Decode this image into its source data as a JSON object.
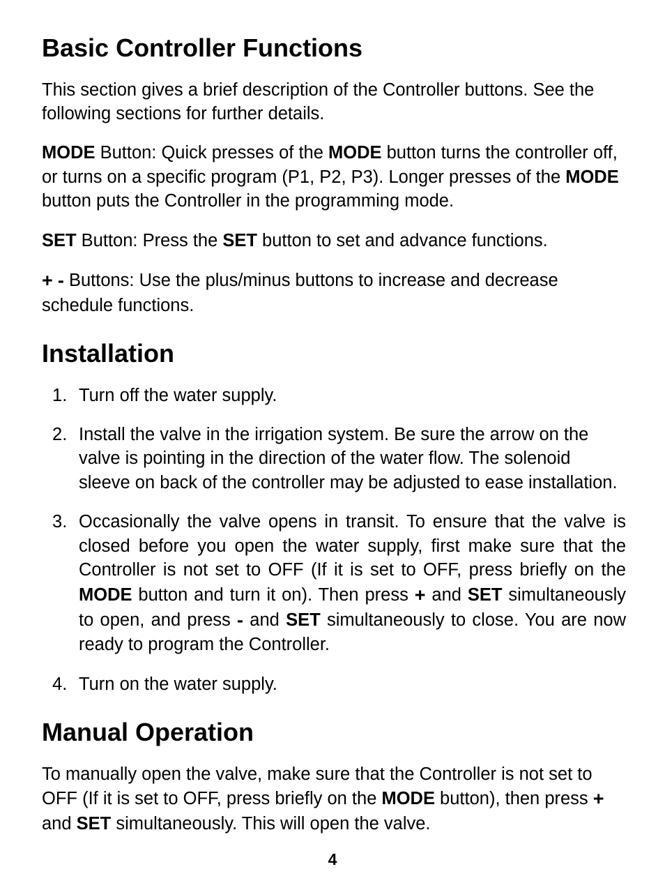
{
  "sections": {
    "basic": {
      "title": "Basic Controller Functions",
      "intro": "This section gives a brief description of the Controller buttons. See the following sections for further details.",
      "mode": {
        "label1": "MODE",
        "t1": " Button: Quick presses of the ",
        "label2": "MODE",
        "t2": " button turns the controller off, or turns on a specific program (P1, P2, P3). Longer presses of the ",
        "label3": "MODE",
        "t3": " button puts the Controller in the programming mode."
      },
      "set": {
        "label1": "SET",
        "t1": " Button: Press the ",
        "label2": "SET",
        "t2": " button to set and advance functions."
      },
      "plusminus": {
        "plus": "+",
        "minus": "-",
        "t1": " Buttons: Use the plus/minus buttons to increase and decrease schedule functions."
      }
    },
    "install": {
      "title": "Installation",
      "steps": {
        "s1": "Turn off the water supply.",
        "s2": "Install the valve in the irrigation system. Be sure the arrow on the valve is pointing in the direction of the water flow. The solenoid sleeve on back of the controller may be adjusted to ease installation.",
        "s3": {
          "t1": "Occasionally the valve opens in transit. To ensure that the valve is closed before you open the water supply, first make sure that the Controller is not set to OFF (If it is set to OFF, press briefly on the ",
          "mode": "MODE",
          "t2": " button and turn it on). Then press ",
          "plus": "+",
          "t3": " and ",
          "set1": "SET",
          "t4": " simultaneously to open, and press ",
          "minus": "-",
          "t5": " and ",
          "set2": "SET",
          "t6": " simultaneously to close. You are now ready to program the Controller."
        },
        "s4": "Turn on the water supply."
      }
    },
    "manual": {
      "title": "Manual Operation",
      "p": {
        "t1": "To manually open the valve, make sure that the Controller is not set to OFF (If it is set to OFF, press briefly on the ",
        "mode": "MODE",
        "t2": " button), then press ",
        "plus": "+",
        "t3": " and ",
        "set": "SET",
        "t4": " simultaneously. This will open the valve."
      }
    }
  },
  "page_number": "4"
}
